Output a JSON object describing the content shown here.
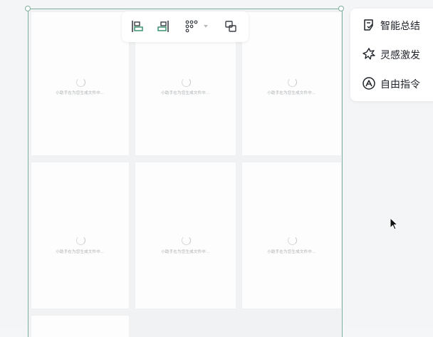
{
  "toolbar": {
    "buttons": [
      "align-left-icon",
      "align-right-icon",
      "grid-layout-icon",
      "group-icon"
    ],
    "accent": "#2e8b67",
    "icon_color": "#3a3f45"
  },
  "cards": [
    {
      "text": "小助手在为您生成文件中..."
    },
    {
      "text": "小助手在为您生成文件中..."
    },
    {
      "text": "小助手在为您生成文件中..."
    },
    {
      "text": "小助手在为您生成文件中..."
    },
    {
      "text": "小助手在为您生成文件中..."
    },
    {
      "text": "小助手在为您生成文件中..."
    }
  ],
  "ai_menu": {
    "items": [
      {
        "label": "智能总结",
        "icon": "summary-icon"
      },
      {
        "label": "灵感激发",
        "icon": "inspiration-icon"
      },
      {
        "label": "自由指令",
        "icon": "instruction-icon"
      }
    ]
  },
  "colors": {
    "selection": "#7fae9c",
    "card_bg": "#fdfdfd",
    "canvas_bg": "#f4f5f6"
  }
}
